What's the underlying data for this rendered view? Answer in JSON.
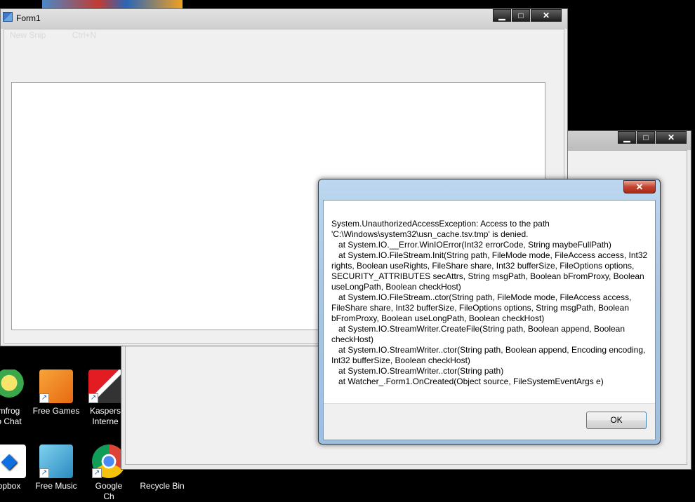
{
  "desktop": {
    "icons": [
      {
        "label_line1": "mfrog",
        "label_line2": "o Chat"
      },
      {
        "label_line1": "Free Games",
        "label_line2": ""
      },
      {
        "label_line1": "Kaspers",
        "label_line2": "Interne"
      },
      {
        "label_line1": "opbox",
        "label_line2": ""
      },
      {
        "label_line1": "Free Music",
        "label_line2": ""
      },
      {
        "label_line1": "Google",
        "label_line2": "Ch"
      },
      {
        "label_line1": "Recycle Bin",
        "label_line2": ""
      }
    ]
  },
  "form1": {
    "title": "Form1",
    "menu": {
      "item": "New Snip",
      "shortcut": "Ctrl+N"
    },
    "buttons": {
      "minimize": "▁",
      "maximize": "□",
      "close": "✕"
    }
  },
  "window2": {
    "buttons": {
      "minimize": "▁",
      "maximize": "□",
      "close": "✕"
    }
  },
  "dialog": {
    "close_label": "✕",
    "message": "System.UnauthorizedAccessException: Access to the path 'C:\\Windows\\system32\\usn_cache.tsv.tmp' is denied.\n   at System.IO.__Error.WinIOError(Int32 errorCode, String maybeFullPath)\n   at System.IO.FileStream.Init(String path, FileMode mode, FileAccess access, Int32 rights, Boolean useRights, FileShare share, Int32 bufferSize, FileOptions options, SECURITY_ATTRIBUTES secAttrs, String msgPath, Boolean bFromProxy, Boolean useLongPath, Boolean checkHost)\n   at System.IO.FileStream..ctor(String path, FileMode mode, FileAccess access, FileShare share, Int32 bufferSize, FileOptions options, String msgPath, Boolean bFromProxy, Boolean useLongPath, Boolean checkHost)\n   at System.IO.StreamWriter.CreateFile(String path, Boolean append, Boolean checkHost)\n   at System.IO.StreamWriter..ctor(String path, Boolean append, Encoding encoding, Int32 bufferSize, Boolean checkHost)\n   at System.IO.StreamWriter..ctor(String path)\n   at Watcher_.Form1.OnCreated(Object source, FileSystemEventArgs e)",
    "ok_label": "OK"
  }
}
